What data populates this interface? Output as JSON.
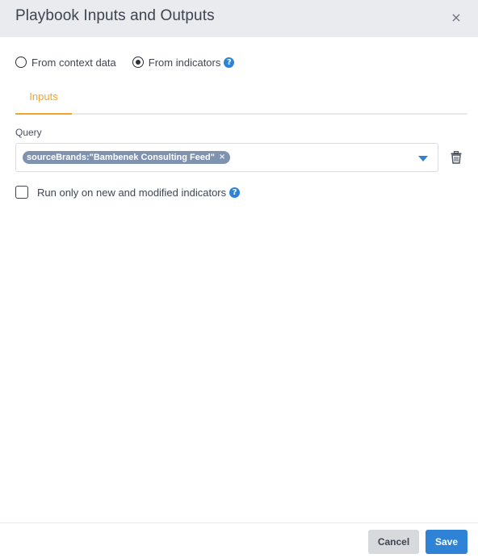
{
  "dialog": {
    "title": "Playbook Inputs and Outputs",
    "close_icon": "×"
  },
  "source": {
    "options": [
      {
        "label": "From context data",
        "selected": false
      },
      {
        "label": "From indicators",
        "selected": true
      }
    ],
    "help_icon": "?"
  },
  "tabs": [
    {
      "label": "Inputs",
      "active": true
    }
  ],
  "query": {
    "label": "Query",
    "chip_text": "sourceBrands:\"Bambenek Consulting Feed\"",
    "chip_remove_icon": "×"
  },
  "run_only": {
    "label": "Run only on new and modified indicators",
    "checked": false,
    "help_icon": "?"
  },
  "footer": {
    "cancel_label": "Cancel",
    "save_label": "Save"
  },
  "colors": {
    "accent": "#f0a62a",
    "primary": "#2e83d6",
    "header_bg": "#e9ebef",
    "chip_bg": "#7f93b1"
  }
}
